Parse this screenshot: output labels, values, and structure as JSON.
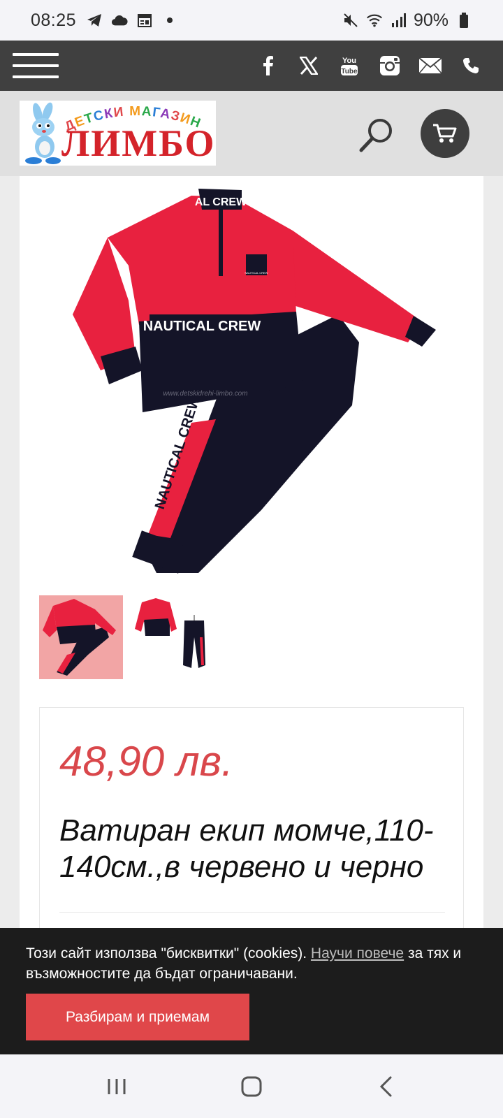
{
  "status": {
    "time": "08:25",
    "battery": "90%",
    "left_icons": [
      "telegram-icon",
      "cloud-icon",
      "calendar-icon",
      "dot-icon"
    ],
    "right_icons": [
      "mute-icon",
      "wifi-icon",
      "signal-icon",
      "battery-icon"
    ]
  },
  "nav": {
    "social": [
      "facebook-icon",
      "x-icon",
      "youtube-icon",
      "instagram-icon",
      "email-icon",
      "phone-icon"
    ],
    "youtube_text": "You Tube"
  },
  "logo": {
    "arc_text": "ДЕТСКИ МАГАЗИН",
    "name": "ЛИМБО"
  },
  "product": {
    "collar_text": "AL CREW",
    "chest_text": "NAUTICAL CREW",
    "leg_text": "NAUTICAL CREW",
    "badge_text": "NAUTICAL CREW",
    "watermark": "www.detskidrehi-limbo.com",
    "price": "48,90 лв.",
    "title": "Ватиран екип момче,110-140см.,в червено и черно"
  },
  "cookie": {
    "text_before": "Този сайт използва \"бисквитки\" (cookies). ",
    "link": "Научи повече",
    "text_after": " за тях и възможностите да бъдат ограничавани.",
    "accept": "Разбирам и приемам"
  },
  "colors": {
    "accent": "#e0474a",
    "price": "#d9474b",
    "topbar": "#404040",
    "garment_red": "#e8213f",
    "garment_black": "#141428"
  }
}
